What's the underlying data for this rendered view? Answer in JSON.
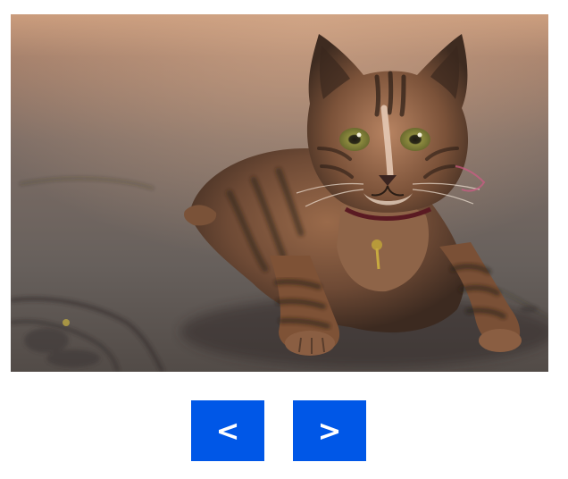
{
  "slideshow": {
    "current_image": {
      "subject": "tabby-kitten-photo"
    },
    "controls": {
      "prev_label": "<",
      "next_label": ">",
      "button_color": "#0057e7"
    }
  }
}
